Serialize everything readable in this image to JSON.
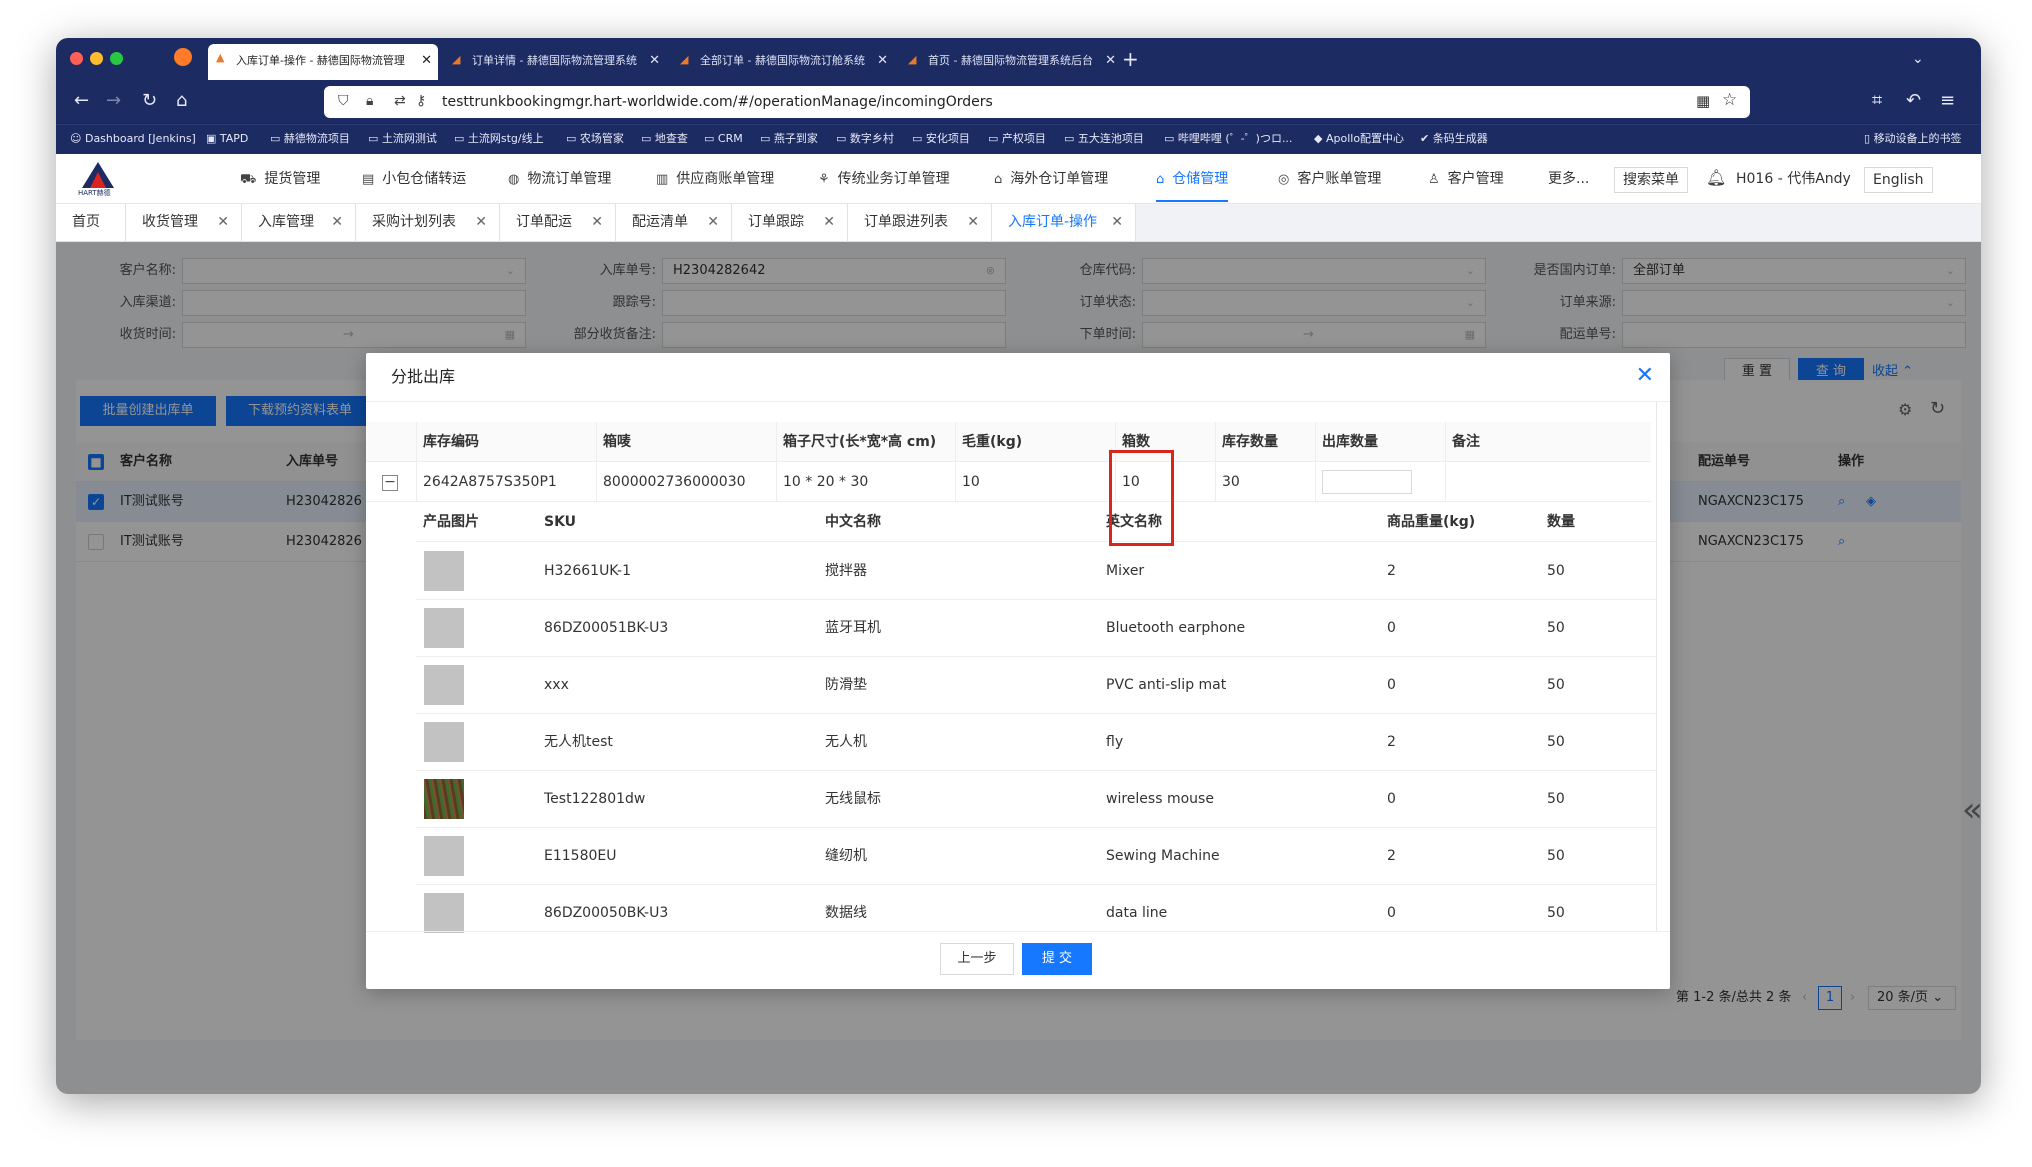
{
  "browser": {
    "tabs": [
      {
        "label": "入库订单-操作 - 赫德国际物流管理",
        "active": true
      },
      {
        "label": "订单详情 - 赫德国际物流管理系统",
        "active": false
      },
      {
        "label": "全部订单 - 赫德国际物流订舱系统",
        "active": false
      },
      {
        "label": "首页 - 赫德国际物流管理系统后台",
        "active": false
      }
    ],
    "url": "testtrunkbookingmgr.hart-worldwide.com/#/operationManage/incomingOrders",
    "bookmarks": [
      "Dashboard [Jenkins]",
      "TAPD",
      "赫德物流项目",
      "土流网测试",
      "土流网stg/线上",
      "农场管家",
      "地查查",
      "CRM",
      "燕子到家",
      "数字乡村",
      "安化项目",
      "产权项目",
      "五大连池项目",
      "哔哩哔哩 (゜-゜)つロ...",
      "Apollo配置中心",
      "条码生成器"
    ],
    "mobile_bookmarks": "移动设备上的书签"
  },
  "header": {
    "logo_text": "HART赫德",
    "menu": [
      {
        "label": "提货管理",
        "icon": "truck-icon"
      },
      {
        "label": "小包仓储转运",
        "icon": "box-icon"
      },
      {
        "label": "物流订单管理",
        "icon": "globe-icon"
      },
      {
        "label": "供应商账单管理",
        "icon": "bill-icon"
      },
      {
        "label": "传统业务订单管理",
        "icon": "tree-icon"
      },
      {
        "label": "海外仓订单管理",
        "icon": "home-icon"
      },
      {
        "label": "仓储管理",
        "icon": "warehouse-icon",
        "active": true
      },
      {
        "label": "客户账单管理",
        "icon": "coin-icon"
      },
      {
        "label": "客户管理",
        "icon": "user-icon"
      },
      {
        "label": "更多...",
        "icon": ""
      }
    ],
    "search_menu": "搜索菜单",
    "user": "H016 - 代伟Andy",
    "language": "English"
  },
  "page_tabs": [
    {
      "label": "首页",
      "closable": false
    },
    {
      "label": "收货管理",
      "closable": true
    },
    {
      "label": "入库管理",
      "closable": true
    },
    {
      "label": "采购计划列表",
      "closable": true
    },
    {
      "label": "订单配运",
      "closable": true
    },
    {
      "label": "配运清单",
      "closable": true
    },
    {
      "label": "订单跟踪",
      "closable": true
    },
    {
      "label": "订单跟进列表",
      "closable": true
    },
    {
      "label": "入库订单-操作",
      "closable": true,
      "active": true
    }
  ],
  "filters": {
    "customer_name": {
      "label": "客户名称:",
      "value": ""
    },
    "inbound_no": {
      "label": "入库单号:",
      "value": "H2304282642"
    },
    "warehouse_code": {
      "label": "仓库代码:",
      "value": ""
    },
    "domestic": {
      "label": "是否国内订单:",
      "value": "全部订单"
    },
    "inbound_channel": {
      "label": "入库渠道:",
      "value": ""
    },
    "tracking_no": {
      "label": "跟踪号:",
      "value": ""
    },
    "order_status": {
      "label": "订单状态:",
      "value": ""
    },
    "order_source": {
      "label": "订单来源:",
      "value": ""
    },
    "receive_time": {
      "label": "收货时间:",
      "value": ""
    },
    "partial_note": {
      "label": "部分收货备注:",
      "value": ""
    },
    "order_time": {
      "label": "下单时间:",
      "value": ""
    },
    "shipping_no": {
      "label": "配运单号:",
      "value": ""
    },
    "reset": "重 置",
    "query": "查 询",
    "collapse": "收起"
  },
  "actions": {
    "batch_create": "批量创建出库单",
    "download": "下载预约资料表单"
  },
  "table": {
    "headers": [
      "客户名称",
      "入库单号",
      "配运单号",
      "操作"
    ],
    "rows": [
      {
        "customer": "IT测试账号",
        "inbound_no": "H23042826",
        "shipping_no": "NGAXCN23C175",
        "checked": true
      },
      {
        "customer": "IT测试账号",
        "inbound_no": "H23042826",
        "shipping_no": "NGAXCN23C175",
        "checked": false
      }
    ]
  },
  "pagination": {
    "summary": "第 1-2 条/总共 2 条",
    "page": "1",
    "page_size": "20 条/页"
  },
  "modal": {
    "title": "分批出库",
    "headers": [
      "库存编码",
      "箱唛",
      "箱子尺寸(长*宽*高 cm)",
      "毛重(kg)",
      "箱数",
      "库存数量",
      "出库数量",
      "备注"
    ],
    "row": {
      "stock_code": "2642A8757S350P1",
      "box_mark": "8000002736000030",
      "size_l": "10",
      "size_w": "20",
      "size_h": "30",
      "gross_weight": "10",
      "box_count": "10",
      "stock_qty": "30",
      "out_qty": "",
      "remark": ""
    },
    "sub_headers": [
      "产品图片",
      "SKU",
      "中文名称",
      "英文名称",
      "商品重量(kg)",
      "数量"
    ],
    "sub_rows": [
      {
        "sku": "H32661UK-1",
        "cn": "搅拌器",
        "en": "Mixer",
        "weight": "2",
        "qty": "50",
        "img": "gray"
      },
      {
        "sku": "86DZ00051BK-U3",
        "cn": "蓝牙耳机",
        "en": "Bluetooth earphone",
        "weight": "0",
        "qty": "50",
        "img": "gray"
      },
      {
        "sku": "xxx",
        "cn": "防滑垫",
        "en": "PVC anti-slip mat",
        "weight": "0",
        "qty": "50",
        "img": "gray"
      },
      {
        "sku": "无人机test",
        "cn": "无人机",
        "en": "fly",
        "weight": "2",
        "qty": "50",
        "img": "gray"
      },
      {
        "sku": "Test122801dw",
        "cn": "无线鼠标",
        "en": "wireless mouse",
        "weight": "0",
        "qty": "50",
        "img": "photo"
      },
      {
        "sku": "E11580EU",
        "cn": "缝纫机",
        "en": "Sewing Machine",
        "weight": "2",
        "qty": "50",
        "img": "gray"
      },
      {
        "sku": "86DZ00050BK-U3",
        "cn": "数据线",
        "en": "data line",
        "weight": "0",
        "qty": "50",
        "img": "gray"
      }
    ],
    "prev": "上一步",
    "submit": "提 交"
  },
  "colors": {
    "accent": "#1677ff",
    "browser_chrome": "#1d2b63",
    "highlight": "#d9251d"
  }
}
